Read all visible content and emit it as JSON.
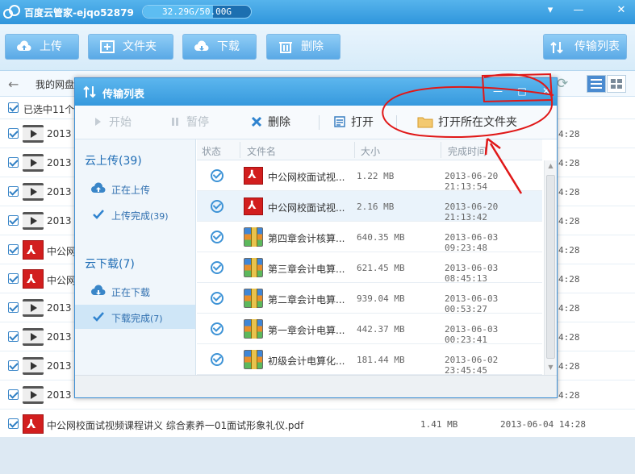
{
  "app": {
    "title": "百度云管家-ejqo52879",
    "quota": "32.29G/50.00G",
    "quota_fraction": 0.6458,
    "window_controls": {
      "menu_glyph": "▾",
      "minimize_glyph": "—",
      "close_glyph": "✕"
    }
  },
  "toolbar": {
    "upload_label": "上传",
    "folder_label": "文件夹",
    "download_label": "下载",
    "delete_label": "删除",
    "transfer_list_label": "传输列表"
  },
  "pathbar": {
    "back_glyph": "←",
    "path": "我的网盘",
    "refresh_glyph": "⟳"
  },
  "selection": {
    "text": "已选中11个"
  },
  "files": [
    {
      "type": "video",
      "name": "2013",
      "size": "",
      "date": "4:28"
    },
    {
      "type": "video",
      "name": "2013",
      "size": "",
      "date": "4:28"
    },
    {
      "type": "video",
      "name": "2013",
      "size": "",
      "date": "4:28"
    },
    {
      "type": "video",
      "name": "2013",
      "size": "",
      "date": "4:28"
    },
    {
      "type": "pdf",
      "name": "中公网",
      "size": "",
      "date": "4:28"
    },
    {
      "type": "pdf",
      "name": "中公网",
      "size": "",
      "date": "4:28"
    },
    {
      "type": "video",
      "name": "2013",
      "size": "",
      "date": "4:28"
    },
    {
      "type": "video",
      "name": "2013",
      "size": "",
      "date": "4:28"
    },
    {
      "type": "video",
      "name": "2013",
      "size": "",
      "date": "4:28"
    },
    {
      "type": "video",
      "name": "2013",
      "size": "",
      "date": "4:28"
    },
    {
      "type": "pdf",
      "name": "中公网校面试视频课程讲义 综合素养一01面试形象礼仪.pdf",
      "size": "1.41 MB",
      "date": "2013-06-04 14:28"
    }
  ],
  "dialog": {
    "title": "传输列表",
    "controls": {
      "minimize_glyph": "—",
      "maximize_glyph": "□",
      "close_glyph": "✕"
    },
    "toolbar": {
      "start_label": "开始",
      "pause_label": "暂停",
      "delete_label": "删除",
      "open_label": "打开",
      "open_folder_label": "打开所在文件夹"
    },
    "sidebar": {
      "upload_head": "云上传",
      "upload_count": "(39)",
      "uploading_label": "正在上传",
      "upload_done_label": "上传完成",
      "upload_done_count": "(39)",
      "download_head": "云下载",
      "download_count": "(7)",
      "downloading_label": "正在下载",
      "download_done_label": "下载完成",
      "download_done_count": "(7)"
    },
    "columns": {
      "status": "状态",
      "name": "文件名",
      "size": "大小",
      "completed": "完成时间"
    },
    "rows": [
      {
        "icon": "pdf",
        "name": "中公网校面试视...",
        "size": "1.22 MB",
        "completed": "2013-06-20 21:13:54"
      },
      {
        "icon": "pdf",
        "name": "中公网校面试视...",
        "size": "2.16 MB",
        "completed": "2013-06-20 21:13:42"
      },
      {
        "icon": "rar",
        "name": "第四章会计核算...",
        "size": "640.35 MB",
        "completed": "2013-06-03 09:23:48"
      },
      {
        "icon": "rar",
        "name": "第三章会计电算...",
        "size": "621.45 MB",
        "completed": "2013-06-03 08:45:13"
      },
      {
        "icon": "rar",
        "name": "第二章会计电算...",
        "size": "939.04 MB",
        "completed": "2013-06-03 00:53:27"
      },
      {
        "icon": "rar",
        "name": "第一章会计电算...",
        "size": "442.37 MB",
        "completed": "2013-06-03 00:23:41"
      },
      {
        "icon": "rar",
        "name": "初级会计电算化...",
        "size": "181.44 MB",
        "completed": "2013-06-02 23:45:45"
      }
    ]
  },
  "colors": {
    "accent": "#3699dd",
    "annotation": "#e01818",
    "pdf_red": "#d21e1e",
    "status_blue": "#3e93d6"
  }
}
